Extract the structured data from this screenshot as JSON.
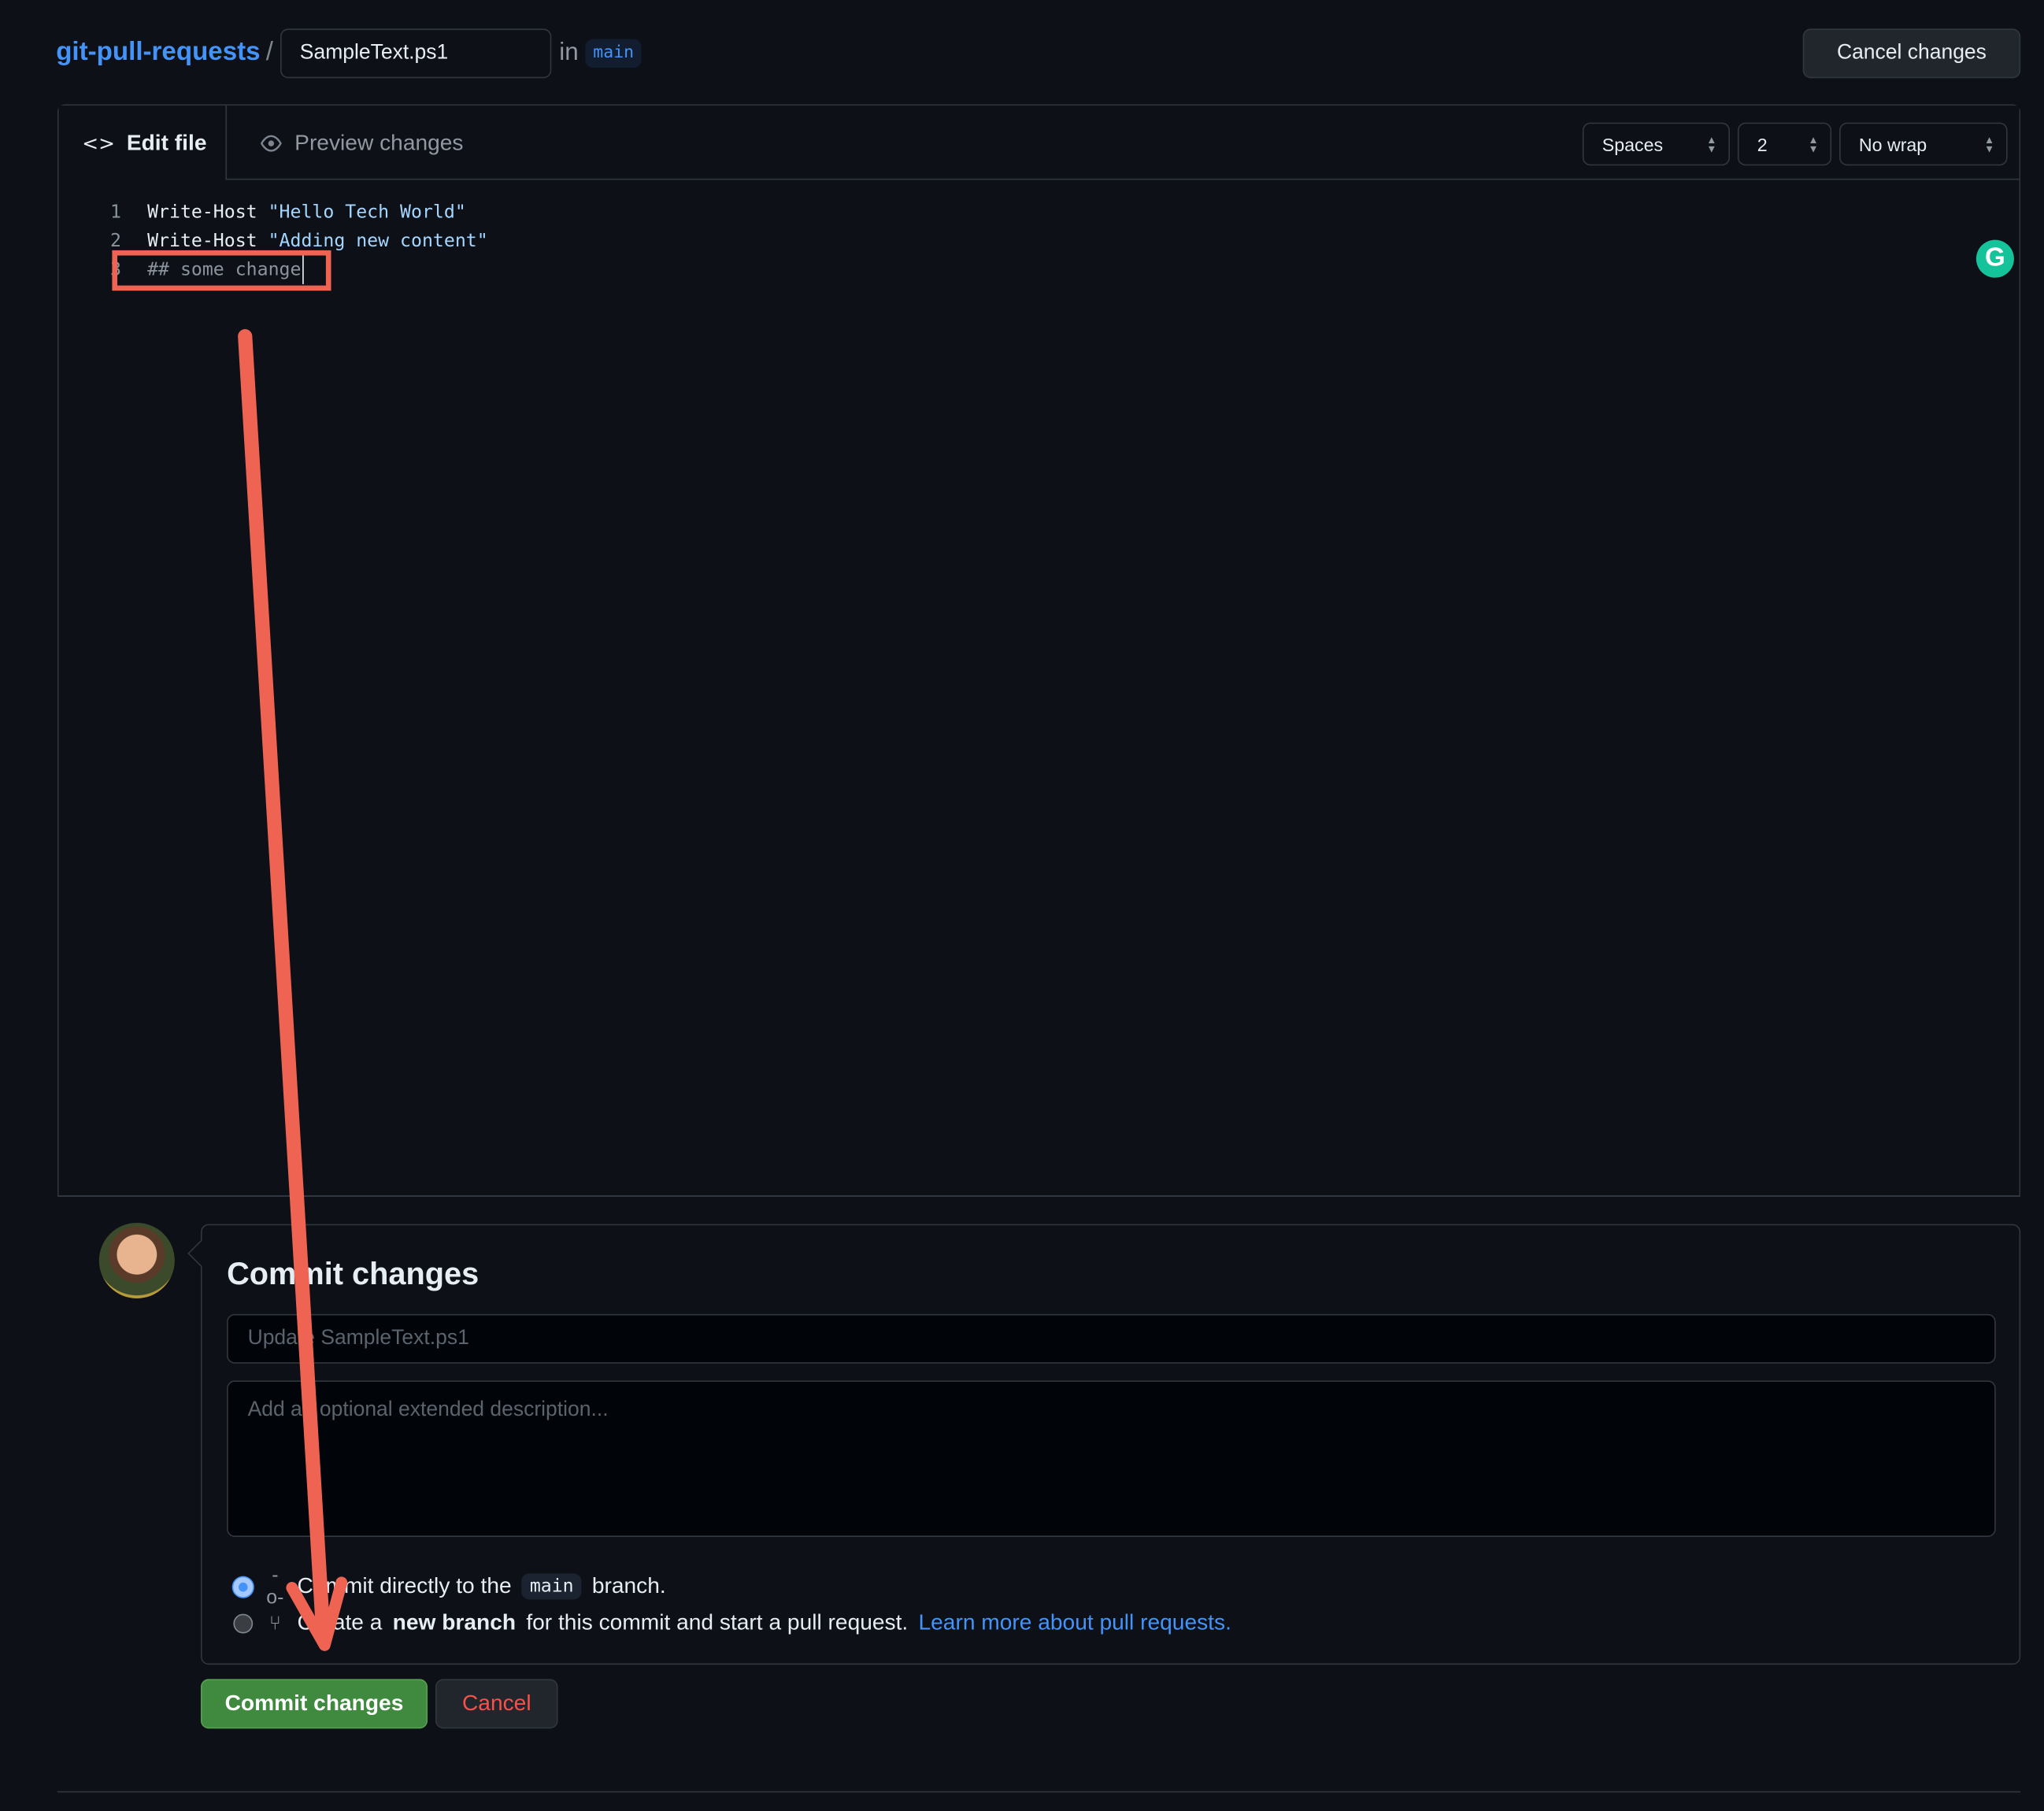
{
  "breadcrumb": {
    "repo": "git-pull-requests",
    "separator": "/",
    "filename": "SampleText.ps1",
    "in_label": "in",
    "branch": "main"
  },
  "header": {
    "cancel_changes": "Cancel changes"
  },
  "editor": {
    "tabs": [
      {
        "label": "Edit file",
        "icon": "code-icon",
        "active": true
      },
      {
        "label": "Preview changes",
        "icon": "eye-icon",
        "active": false
      }
    ],
    "indent_mode": "Spaces",
    "indent_size": "2",
    "wrap_mode": "No wrap",
    "lines": [
      {
        "num": "1",
        "cmd": "Write-Host ",
        "str": "\"Hello Tech World\""
      },
      {
        "num": "2",
        "cmd": "Write-Host ",
        "str": "\"Adding new content\""
      },
      {
        "num": "3",
        "comment": "## some change"
      }
    ],
    "grammarly_letter": "G"
  },
  "commit": {
    "title": "Commit changes",
    "message_placeholder": "Update SampleText.ps1",
    "description_placeholder": "Add an optional extended description...",
    "option_direct": {
      "prefix": "Commit directly to the",
      "branch": "main",
      "suffix": "branch.",
      "selected": true
    },
    "option_new": {
      "prefix": "Create a",
      "bold": "new branch",
      "suffix": "for this commit and start a pull request.",
      "link": "Learn more about pull requests.",
      "selected": false
    },
    "commit_button": "Commit changes",
    "cancel_button": "Cancel"
  },
  "colors": {
    "accent": "#4493f8",
    "annotation": "#ee6352",
    "commit_button": "#3f8a3f",
    "danger": "#f85149"
  }
}
